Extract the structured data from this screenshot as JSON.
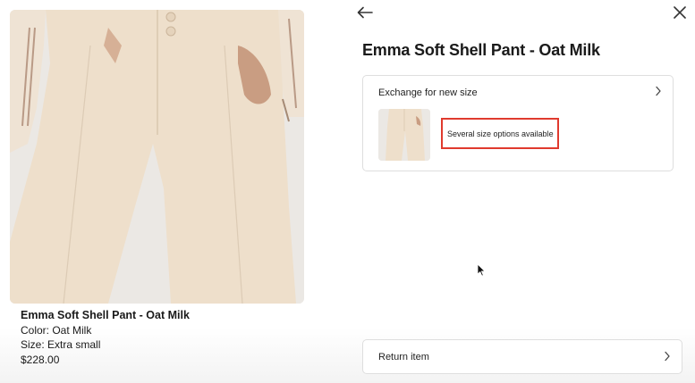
{
  "product": {
    "name": "Emma Soft Shell Pant - Oat Milk",
    "color": "Color: Oat Milk",
    "size": "Size: Extra small",
    "price": "$228.00"
  },
  "panel": {
    "title": "Emma Soft Shell Pant - Oat Milk",
    "exchange": {
      "label": "Exchange for new size",
      "option_text": "Several size options available"
    },
    "return_label": "Return item"
  },
  "icons": {
    "back": "arrow-left-icon",
    "close": "close-icon",
    "chevron": "chevron-right-icon"
  },
  "colors": {
    "highlight": "#e03a2e",
    "pant": "#eedfcb",
    "border": "#dedede"
  }
}
